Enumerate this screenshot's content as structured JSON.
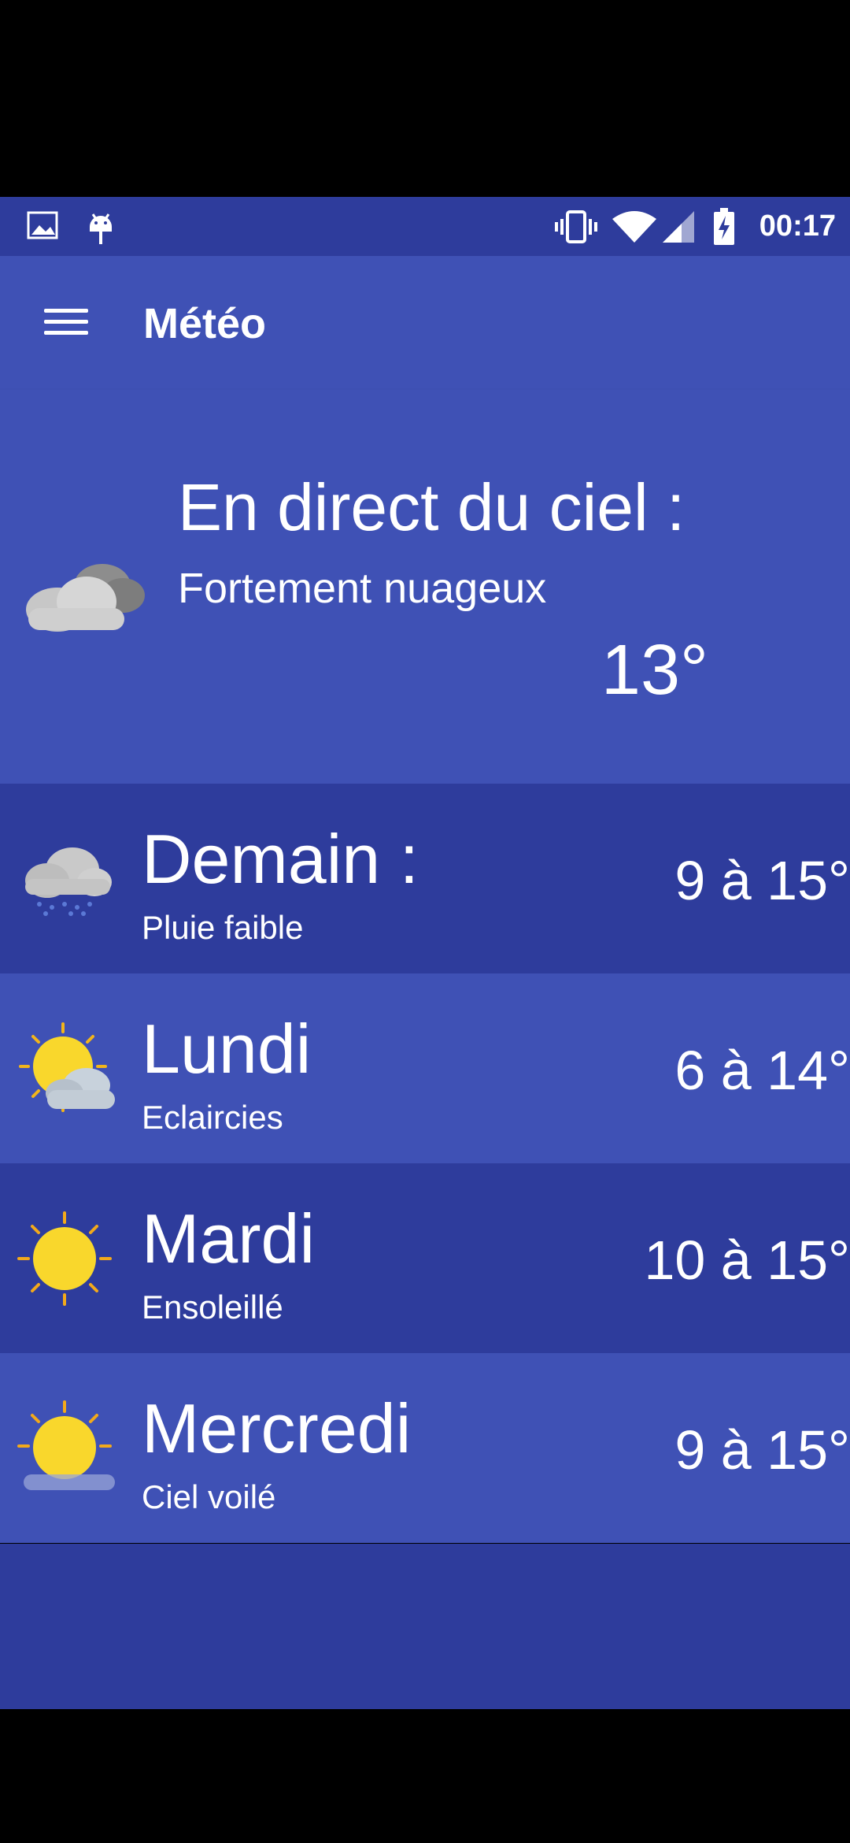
{
  "status_bar": {
    "time": "00:17",
    "left_icons": [
      "image-icon",
      "android-icon"
    ],
    "right_icons": [
      "vibrate-icon",
      "wifi-icon",
      "signal-icon",
      "battery-charging-icon"
    ]
  },
  "app_bar": {
    "title": "Météo",
    "menu_icon": "hamburger-menu-icon"
  },
  "current": {
    "title": "En direct du ciel :",
    "condition": "Fortement nuageux",
    "temperature": "13°",
    "icon": "cloudy-icon"
  },
  "forecast": [
    {
      "day": "Demain :",
      "condition": "Pluie faible",
      "range": "9 à 15°",
      "icon": "light-rain-icon"
    },
    {
      "day": "Lundi",
      "condition": "Eclaircies",
      "range": "6 à 14°",
      "icon": "partly-sunny-icon"
    },
    {
      "day": "Mardi",
      "condition": "Ensoleillé",
      "range": "10 à 15°",
      "icon": "sunny-icon"
    },
    {
      "day": "Mercredi",
      "condition": "Ciel voilé",
      "range": "9 à 15°",
      "icon": "hazy-sun-icon"
    }
  ],
  "colors": {
    "primary": "#3F51B5",
    "primary_dark": "#2E3C9C",
    "text": "#FFFFFF"
  }
}
